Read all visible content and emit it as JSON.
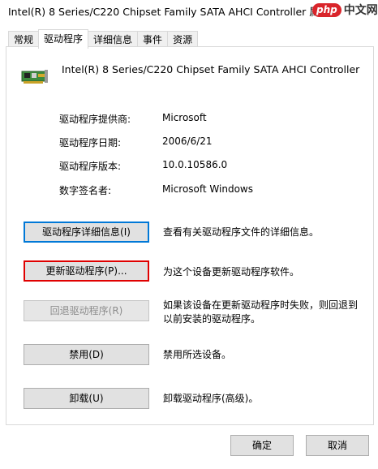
{
  "window": {
    "title": "Intel(R) 8 Series/C220 Chipset Family SATA AHCI Controller  属性",
    "watermark_logo": "php",
    "watermark_text": "中文网"
  },
  "tabs": [
    {
      "label": "常规",
      "active": false
    },
    {
      "label": "驱动程序",
      "active": true
    },
    {
      "label": "详细信息",
      "active": false
    },
    {
      "label": "事件",
      "active": false
    },
    {
      "label": "资源",
      "active": false
    }
  ],
  "device": {
    "name": "Intel(R) 8 Series/C220 Chipset Family SATA AHCI Controller",
    "icon": "chip-card-icon"
  },
  "info": {
    "provider_label": "驱动程序提供商:",
    "provider_value": "Microsoft",
    "date_label": "驱动程序日期:",
    "date_value": "2006/6/21",
    "version_label": "驱动程序版本:",
    "version_value": "10.0.10586.0",
    "signer_label": "数字签名者:",
    "signer_value": "Microsoft Windows"
  },
  "actions": {
    "details_button": "驱动程序详细信息(I)",
    "details_desc": "查看有关驱动程序文件的详细信息。",
    "update_button": "更新驱动程序(P)...",
    "update_desc": "为这个设备更新驱动程序软件。",
    "rollback_button": "回退驱动程序(R)",
    "rollback_desc": "如果该设备在更新驱动程序时失败，则回退到以前安装的驱动程序。",
    "disable_button": "禁用(D)",
    "disable_desc": "禁用所选设备。",
    "uninstall_button": "卸载(U)",
    "uninstall_desc": "卸载驱动程序(高级)。"
  },
  "footer": {
    "ok_button": "确定",
    "cancel_button": "取消"
  },
  "colors": {
    "focus_border": "#0078d7",
    "highlight_border": "#e00000",
    "watermark_red": "#d9252b"
  }
}
